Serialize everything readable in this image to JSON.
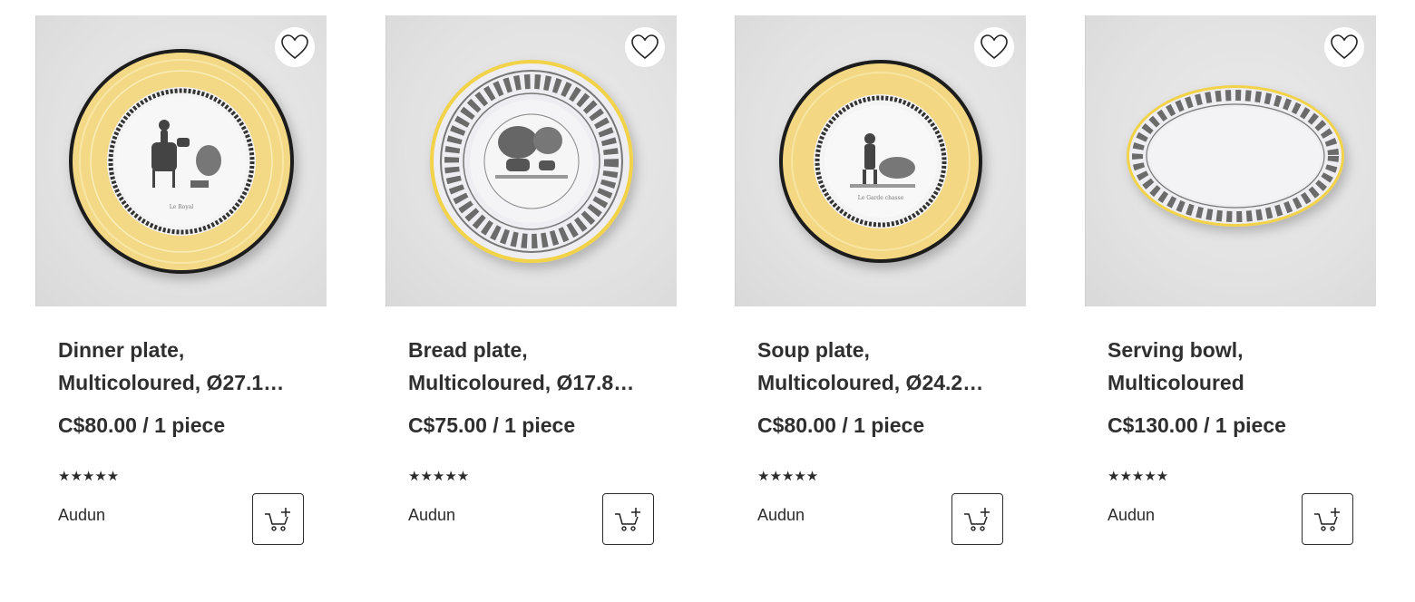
{
  "products": [
    {
      "title_line1": "Dinner plate,",
      "title_line2": "Multicoloured, Ø27.1…",
      "price": "C$80.00 / 1 piece",
      "rating": "★★★★★",
      "brand": "Audun",
      "image": "dinner-plate-yellow-rim"
    },
    {
      "title_line1": "Bread plate,",
      "title_line2": "Multicoloured, Ø17.8…",
      "price": "C$75.00 / 1 piece",
      "rating": "★★★★★",
      "brand": "Audun",
      "image": "bread-plate-floral-rim"
    },
    {
      "title_line1": "Soup plate,",
      "title_line2": "Multicoloured, Ø24.2…",
      "price": "C$80.00 / 1 piece",
      "rating": "★★★★★",
      "brand": "Audun",
      "image": "soup-plate-yellow-rim"
    },
    {
      "title_line1": "Serving bowl,",
      "title_line2": "Multicoloured",
      "price": "C$130.00 / 1 piece",
      "rating": "★★★★★",
      "brand": "Audun",
      "image": "serving-bowl-oval-floral"
    }
  ],
  "icons": {
    "favorite": "heart-icon",
    "add_to_cart": "cart-plus-icon"
  },
  "colors": {
    "plate_yellow": "#f2d77a",
    "plate_rim_dark": "#1e1e1e",
    "text": "#2f2f2f"
  }
}
